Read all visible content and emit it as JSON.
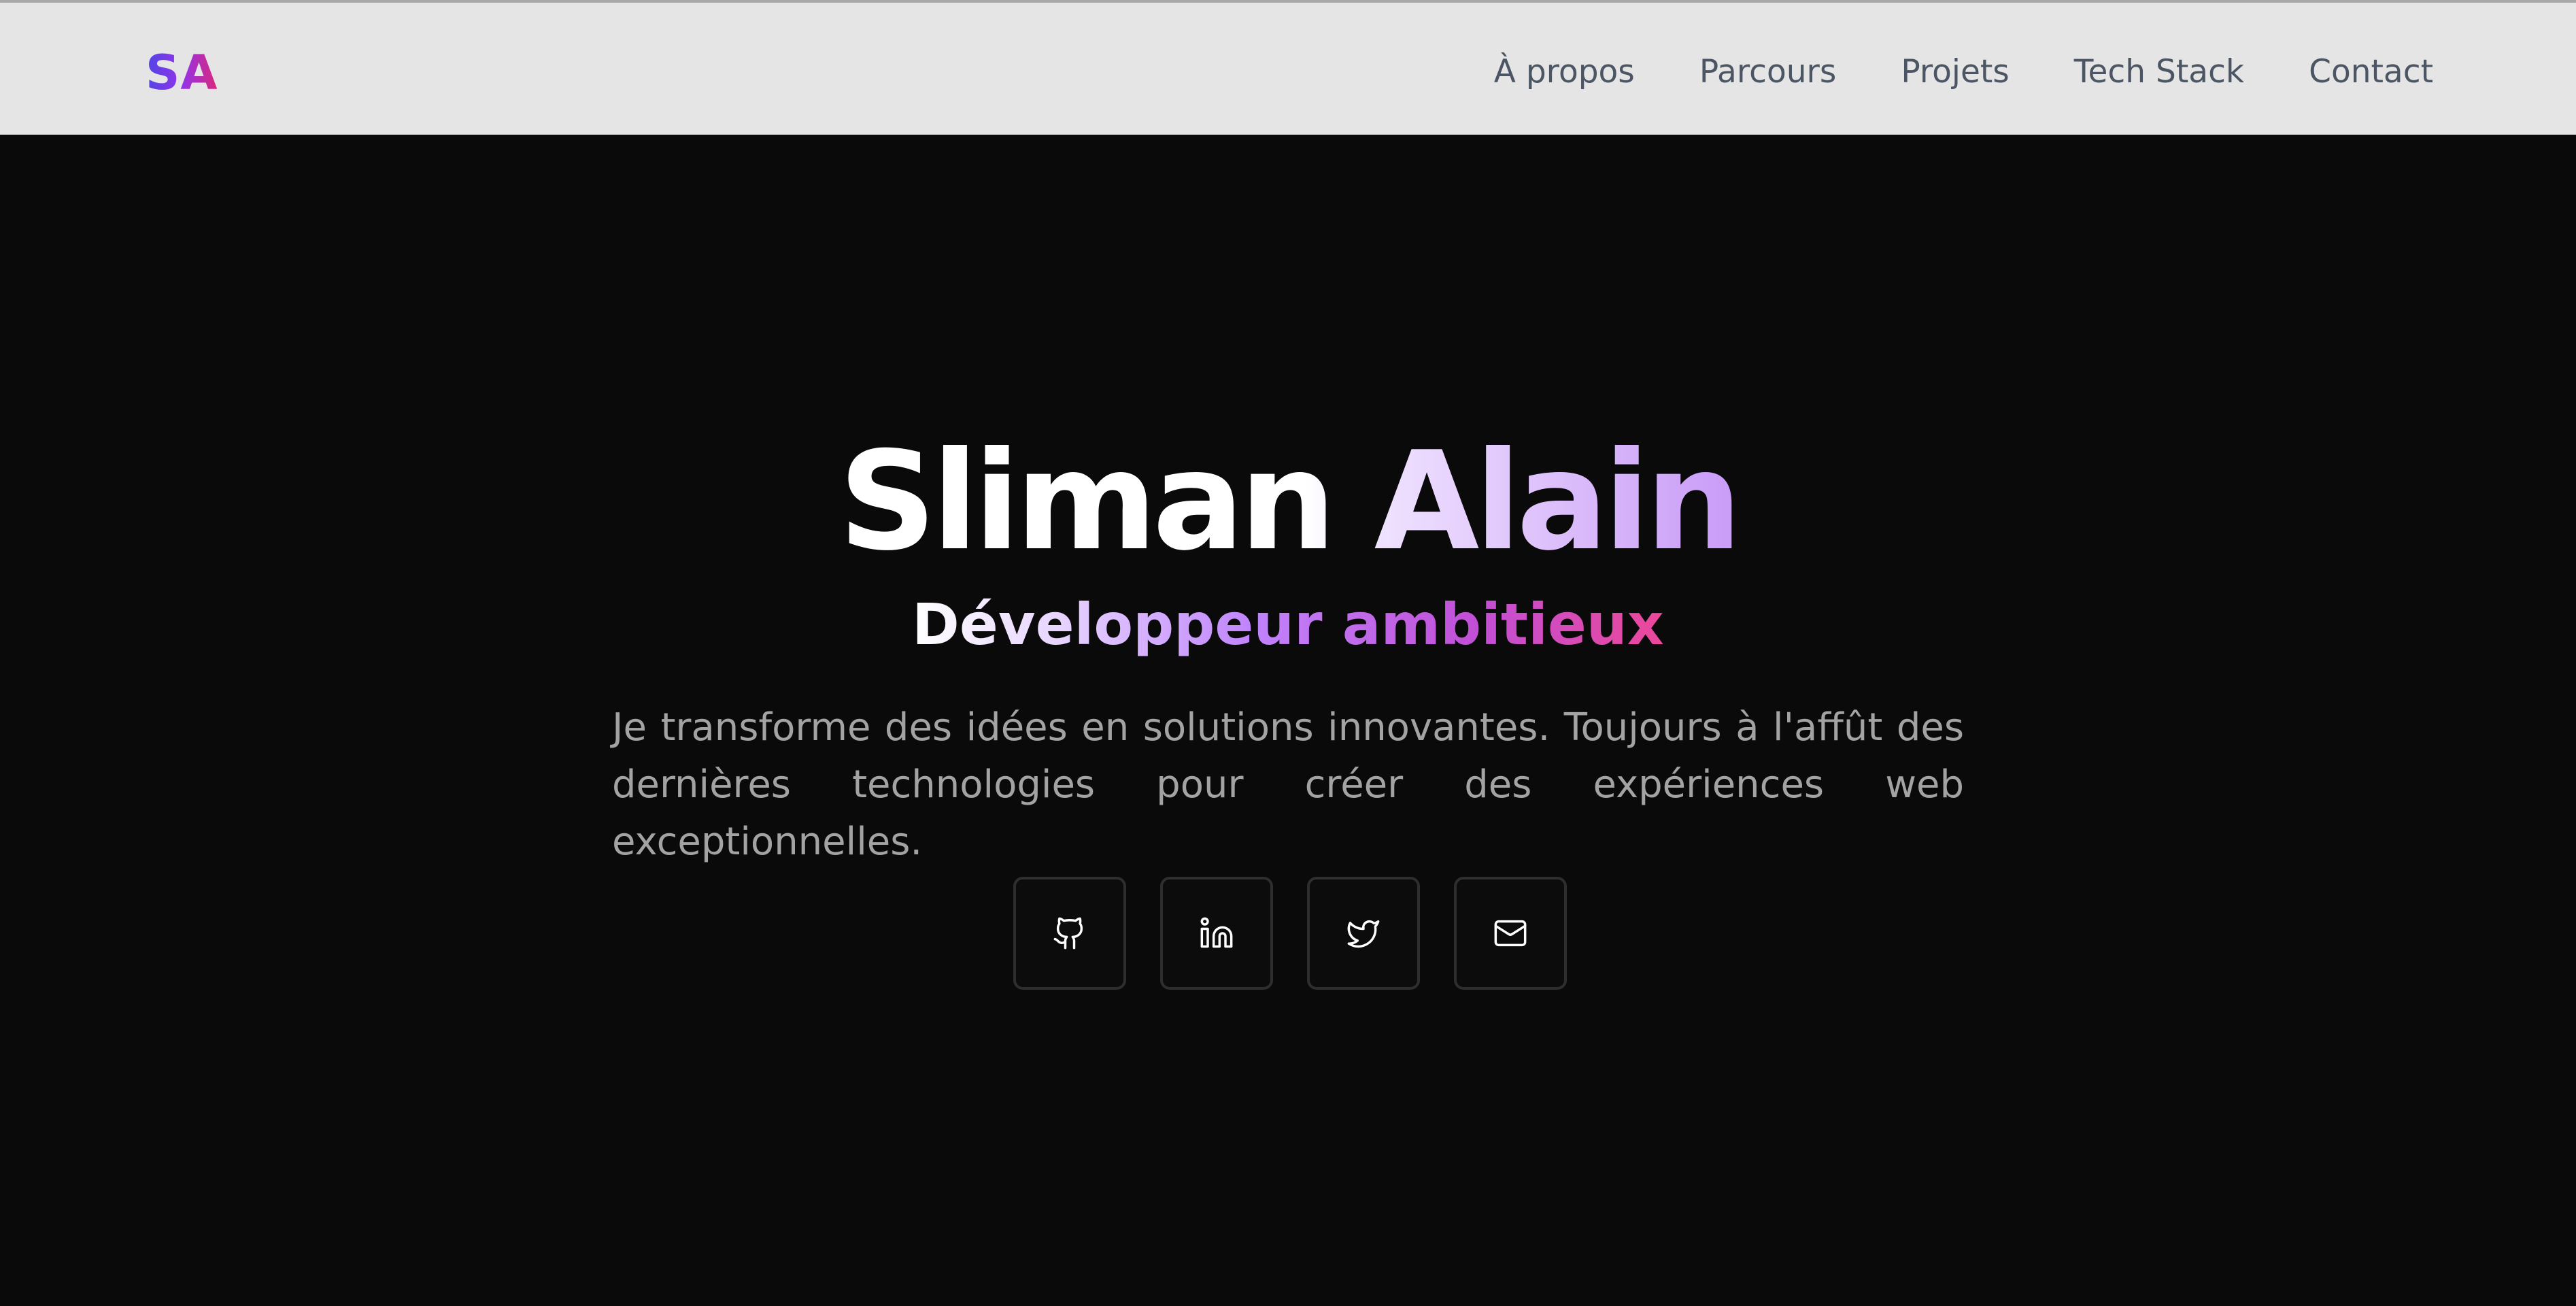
{
  "navbar": {
    "logo": "SA",
    "links": [
      {
        "label": "À propos"
      },
      {
        "label": "Parcours"
      },
      {
        "label": "Projets"
      },
      {
        "label": "Tech Stack"
      },
      {
        "label": "Contact"
      }
    ]
  },
  "hero": {
    "name": "Sliman Alain",
    "subtitle": "Développeur ambitieux",
    "description": "Je transforme des idées en solutions innovantes. Toujours à l'affût des dernières technologies pour créer des expériences web exceptionnelles.",
    "socials": [
      {
        "icon": "github-icon"
      },
      {
        "icon": "linkedin-icon"
      },
      {
        "icon": "twitter-icon"
      },
      {
        "icon": "mail-icon"
      }
    ]
  },
  "colors": {
    "background": "#0a0a0a",
    "navbar_background": "#e5e5e5",
    "nav_text": "#4b5563",
    "description_text": "#a3a3a3",
    "accent_purple": "#c084fc",
    "accent_pink": "#ec4899",
    "logo_blue": "#4f46e5"
  }
}
